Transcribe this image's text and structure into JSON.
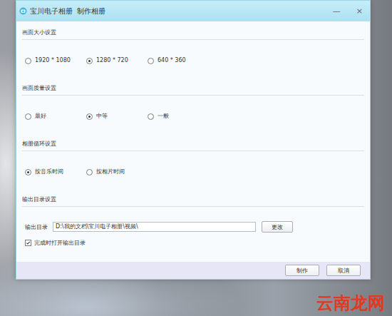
{
  "window": {
    "title": "宝川电子相册  制作相册",
    "controls": [
      "—",
      "×"
    ]
  },
  "sections": [
    {
      "title": "画面大小设置",
      "kind": "radio",
      "options": [
        {
          "label": "1920 * 1080",
          "selected": false
        },
        {
          "label": "1280 * 720",
          "selected": true
        },
        {
          "label": "640 * 360",
          "selected": false
        }
      ]
    },
    {
      "title": "画面质量设置",
      "kind": "radio",
      "options": [
        {
          "label": "最好",
          "selected": false
        },
        {
          "label": "中等",
          "selected": true
        },
        {
          "label": "一般",
          "selected": false
        }
      ]
    },
    {
      "title": "相册循环设置",
      "kind": "radio",
      "options": [
        {
          "label": "按音乐时间",
          "selected": true
        },
        {
          "label": "按相片时间",
          "selected": false
        }
      ]
    },
    {
      "title": "输出目录设置",
      "kind": "folder",
      "field": {
        "label": "输出目录",
        "value": "D:\\我的文档\\宝川电子相册\\视频\\"
      },
      "button": "更改",
      "checkbox": {
        "label": "完成时打开输出目录",
        "checked": true
      }
    }
  ],
  "buttons": [
    "制作",
    "取消"
  ],
  "watermark": "云南龙网"
}
